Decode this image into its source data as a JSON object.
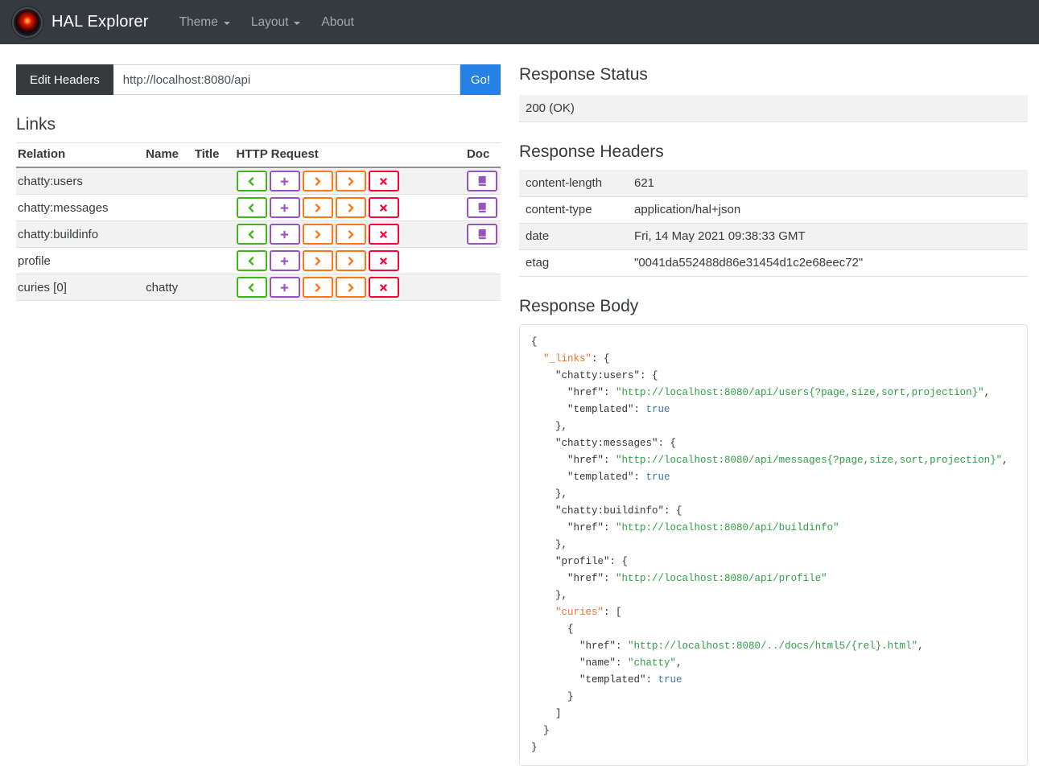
{
  "colors": {
    "navbar_bg": "#343a40",
    "primary_blue": "#2780e3",
    "success_green": "#3fb618",
    "info_purple": "#9954bb",
    "warning_orange": "#ff7518",
    "danger_red": "#ff0039",
    "dark_button": "#373a3c",
    "stripe_gray": "#f2f2f2",
    "border_gray": "#dee2e6",
    "json_key_hal": "#e8722c",
    "json_string": "#2f9e44",
    "json_literal": "#3a77b8",
    "json_plain": "#333333"
  },
  "navbar": {
    "brand": "HAL Explorer",
    "items": [
      {
        "label": "Theme",
        "caret": true
      },
      {
        "label": "Layout",
        "caret": true
      },
      {
        "label": "About",
        "caret": false
      }
    ]
  },
  "request_bar": {
    "edit_headers_label": "Edit Headers",
    "url_value": "http://localhost:8080/api",
    "go_label": "Go!"
  },
  "links_section": {
    "title": "Links",
    "columns": [
      "Relation",
      "Name",
      "Title",
      "HTTP Request",
      "Doc"
    ],
    "http_buttons": [
      {
        "name": "http-get",
        "icon": "chevron-left",
        "color_key": "success_green"
      },
      {
        "name": "http-post",
        "icon": "plus",
        "color_key": "info_purple"
      },
      {
        "name": "http-put",
        "icon": "chevron-right",
        "color_key": "warning_orange"
      },
      {
        "name": "http-patch",
        "icon": "chevron-right",
        "color_key": "warning_orange"
      },
      {
        "name": "http-delete",
        "icon": "x",
        "color_key": "danger_red"
      }
    ],
    "rows": [
      {
        "relation": "chatty:users",
        "name": "",
        "title": "",
        "doc": true
      },
      {
        "relation": "chatty:messages",
        "name": "",
        "title": "",
        "doc": true
      },
      {
        "relation": "chatty:buildinfo",
        "name": "",
        "title": "",
        "doc": true
      },
      {
        "relation": "profile",
        "name": "",
        "title": "",
        "doc": false
      },
      {
        "relation": "curies [0]",
        "name": "chatty",
        "title": "",
        "doc": false
      }
    ]
  },
  "response": {
    "status_title": "Response Status",
    "status_value": "200 (OK)",
    "headers_title": "Response Headers",
    "headers": [
      {
        "key": "content-length",
        "value": "621"
      },
      {
        "key": "content-type",
        "value": "application/hal+json"
      },
      {
        "key": "date",
        "value": "Fri, 14 May 2021 09:38:33 GMT"
      },
      {
        "key": "etag",
        "value": "\"0041da552488d86e31454d1c2e68eec72\""
      }
    ],
    "body_title": "Response Body",
    "body_lines": [
      [
        [
          "d",
          "{"
        ]
      ],
      [
        [
          "d",
          "  "
        ],
        [
          "h",
          "\"_links\""
        ],
        [
          "d",
          ": {"
        ]
      ],
      [
        [
          "d",
          "    \"chatty:users\": {"
        ]
      ],
      [
        [
          "d",
          "      \"href\": "
        ],
        [
          "s",
          "\"http://localhost:8080/api/users{?page,size,sort,projection}\""
        ],
        [
          "d",
          ","
        ]
      ],
      [
        [
          "d",
          "      \"templated\": "
        ],
        [
          "b",
          "true"
        ]
      ],
      [
        [
          "d",
          "    },"
        ]
      ],
      [
        [
          "d",
          "    \"chatty:messages\": {"
        ]
      ],
      [
        [
          "d",
          "      \"href\": "
        ],
        [
          "s",
          "\"http://localhost:8080/api/messages{?page,size,sort,projection}\""
        ],
        [
          "d",
          ","
        ]
      ],
      [
        [
          "d",
          "      \"templated\": "
        ],
        [
          "b",
          "true"
        ]
      ],
      [
        [
          "d",
          "    },"
        ]
      ],
      [
        [
          "d",
          "    \"chatty:buildinfo\": {"
        ]
      ],
      [
        [
          "d",
          "      \"href\": "
        ],
        [
          "s",
          "\"http://localhost:8080/api/buildinfo\""
        ]
      ],
      [
        [
          "d",
          "    },"
        ]
      ],
      [
        [
          "d",
          "    \"profile\": {"
        ]
      ],
      [
        [
          "d",
          "      \"href\": "
        ],
        [
          "s",
          "\"http://localhost:8080/api/profile\""
        ]
      ],
      [
        [
          "d",
          "    },"
        ]
      ],
      [
        [
          "d",
          "    "
        ],
        [
          "h",
          "\"curies\""
        ],
        [
          "d",
          ": ["
        ]
      ],
      [
        [
          "d",
          "      {"
        ]
      ],
      [
        [
          "d",
          "        \"href\": "
        ],
        [
          "s",
          "\"http://localhost:8080/../docs/html5/{rel}.html\""
        ],
        [
          "d",
          ","
        ]
      ],
      [
        [
          "d",
          "        \"name\": "
        ],
        [
          "s",
          "\"chatty\""
        ],
        [
          "d",
          ","
        ]
      ],
      [
        [
          "d",
          "        \"templated\": "
        ],
        [
          "b",
          "true"
        ]
      ],
      [
        [
          "d",
          "      }"
        ]
      ],
      [
        [
          "d",
          "    ]"
        ]
      ],
      [
        [
          "d",
          "  }"
        ]
      ],
      [
        [
          "d",
          "}"
        ]
      ]
    ]
  }
}
